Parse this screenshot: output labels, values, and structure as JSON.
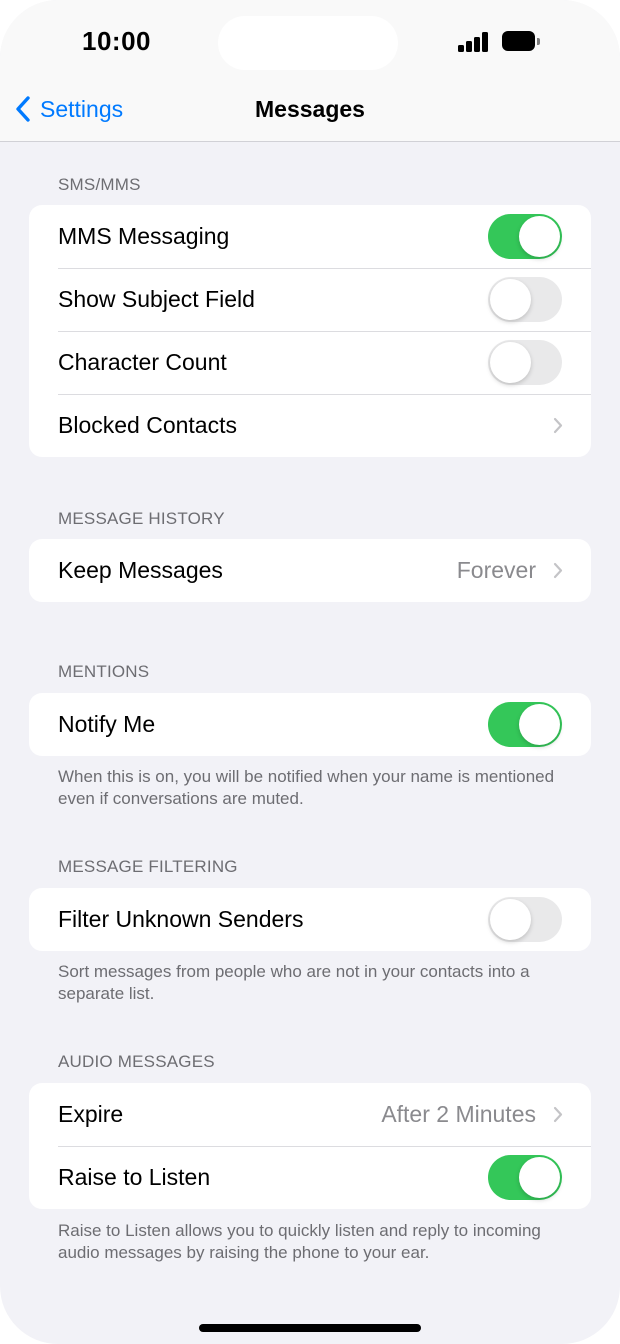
{
  "status": {
    "time": "10:00"
  },
  "nav": {
    "back_label": "Settings",
    "title": "Messages"
  },
  "sections": {
    "sms": {
      "header": "SMS/MMS",
      "rows": [
        {
          "label": "MMS Messaging",
          "toggle": "on"
        },
        {
          "label": "Show Subject Field",
          "toggle": "off"
        },
        {
          "label": "Character Count",
          "toggle": "off"
        },
        {
          "label": "Blocked Contacts"
        }
      ]
    },
    "history": {
      "header": "MESSAGE HISTORY",
      "rows": [
        {
          "label": "Keep Messages",
          "value": "Forever"
        }
      ]
    },
    "mentions": {
      "header": "MENTIONS",
      "rows": [
        {
          "label": "Notify Me",
          "toggle": "on"
        }
      ],
      "footer": "When this is on, you will be notified when your name is mentioned even if conversations are muted."
    },
    "filtering": {
      "header": "MESSAGE FILTERING",
      "rows": [
        {
          "label": "Filter Unknown Senders",
          "toggle": "off"
        }
      ],
      "footer": "Sort messages from people who are not in your contacts into a separate list."
    },
    "audio": {
      "header": "AUDIO MESSAGES",
      "rows": [
        {
          "label": "Expire",
          "value": "After 2 Minutes"
        },
        {
          "label": "Raise to Listen",
          "toggle": "on"
        }
      ],
      "footer": "Raise to Listen allows you to quickly listen and reply to incoming audio messages by raising the phone to your ear."
    }
  },
  "colors": {
    "accent": "#007aff",
    "toggle_on": "#34c759",
    "toggle_off": "#e9e9ea",
    "background": "#f2f2f7"
  },
  "icons": [
    "back-chevron-icon",
    "chevron-right-icon",
    "signal-icon",
    "battery-icon"
  ]
}
